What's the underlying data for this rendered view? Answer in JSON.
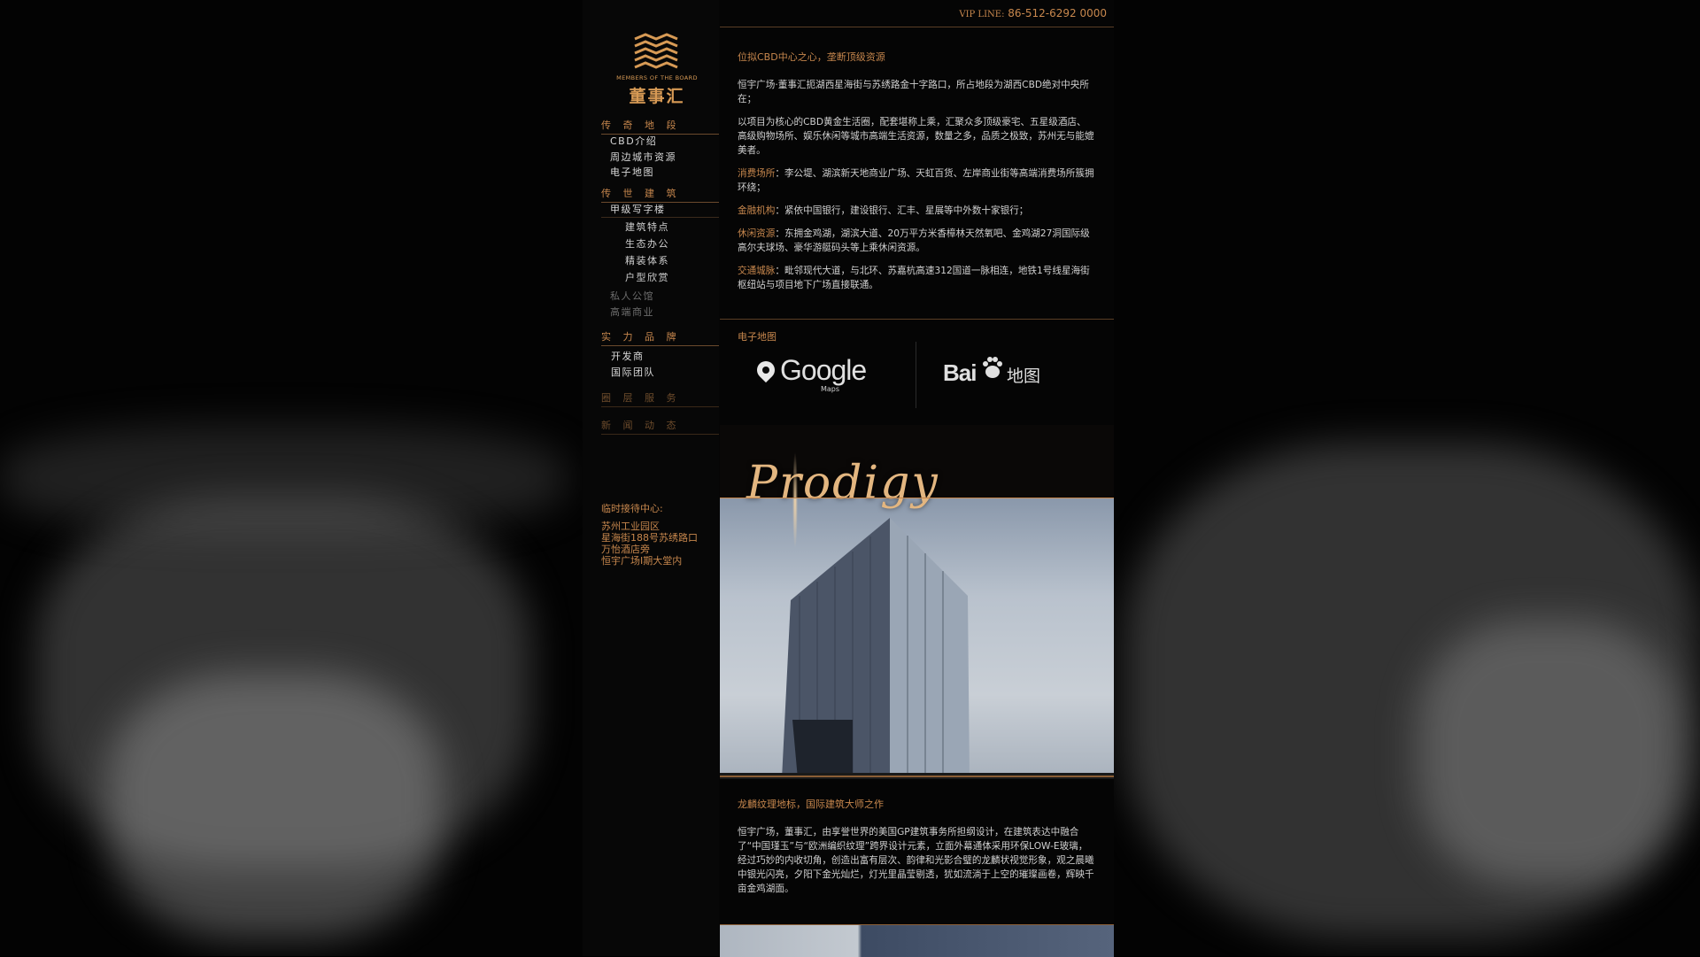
{
  "header": {
    "vip_label": "VIP LINE:",
    "vip_number": "86-512-6292 0000"
  },
  "logo": {
    "en": "MEMBERS OF THE BOARD",
    "cn": "董事汇"
  },
  "sidebar": {
    "sections": [
      {
        "label": "传 奇 地 段"
      },
      {
        "label": "传 世 建 筑"
      },
      {
        "label": "实 力 品 牌"
      },
      {
        "label": "圈 层 服 务"
      },
      {
        "label": "新 闻 动 态"
      }
    ],
    "items": {
      "cbd_intro": "CBD介绍",
      "city_resources": "周边城市资源",
      "e_map": "电子地图",
      "office": "甲级写字楼",
      "arch_features": "建筑特点",
      "eco_office": "生态办公",
      "fitout": "精装体系",
      "floor_plans": "户型欣赏",
      "private_apartment": "私人公馆",
      "premium_retail": "高端商业",
      "developer": "开发商",
      "intl_team": "国际团队"
    },
    "reception_title": "临时接待中心:",
    "reception_lines": [
      "苏州工业园区",
      "星海街188号苏绣路口",
      "万怡酒店旁",
      "恒宇广场Ⅰ期大堂内"
    ]
  },
  "main": {
    "headline1": "位拟CBD中心之心，垄断顶级资源",
    "para1": "恒宇广场·董事汇扼湖西星海街与苏绣路金十字路口，所占地段为湖西CBD绝对中央所在；",
    "para2": "以项目为核心的CBD黄金生活圈，配套堪称上乘，汇聚众多顶级豪宅、五星级酒店、高级购物场所、娱乐休闲等城市高端生活资源，数量之多，品质之极致，苏州无与能媲美者。",
    "items": [
      {
        "key": "消费场所",
        "text": "：李公堤、湖滨新天地商业广场、天虹百货、左岸商业街等高端消费场所簇拥环绕；"
      },
      {
        "key": "金融机构",
        "text": "：紧依中国银行，建设银行、汇丰、星展等中外数十家银行；"
      },
      {
        "key": "休闲资源",
        "text": "：东拥金鸡湖，湖滨大道、20万平方米香樟林天然氧吧、金鸡湖27洞国际级高尔夫球场、豪华游艇码头等上乘休闲资源。"
      },
      {
        "key": "交通城脉",
        "text": "：毗邻现代大道，与北环、苏嘉杭高速312国道一脉相连，地铁1号线星海街枢纽站与项目地下广场直接联通。"
      }
    ],
    "map_title": "电子地图",
    "google_text": "Google",
    "google_sub": "Maps",
    "baidu_text": "Bai",
    "baidu_cn": "地图",
    "prodigy_text": "Prodigy",
    "headline2": "龙麟纹理地标，国际建筑大师之作",
    "para3": "恒宇广场，董事汇，由享誉世界的美国GP建筑事务所担纲设计，在建筑表达中融合了“中国瑾玉”与“欧洲编织纹理”跨界设计元素，立面外幕通体采用环保LOW-E玻璃，经过巧妙的内收切角，创造出富有层次、韵律和光影合璧的龙麟状视觉形象，观之晨曦中银光闪亮，夕阳下金光灿烂，灯光里晶莹剔透，犹如流淌于上空的璀璨画卷，辉映千亩金鸡湖面。"
  },
  "colors": {
    "accent": "#c7874d",
    "text": "#d0d0d0",
    "bg": "#050505"
  }
}
